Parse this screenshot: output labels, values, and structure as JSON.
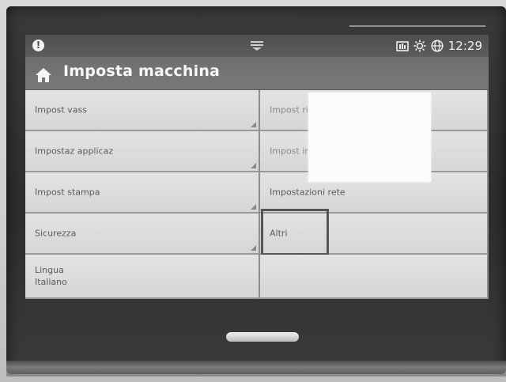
{
  "statusbar": {
    "alert_icon": "info-alert-icon",
    "time": "12:29",
    "icons": [
      "toner-icon",
      "sleep-brightness-icon",
      "network-globe-icon"
    ]
  },
  "header": {
    "title": "Imposta macchina",
    "home_icon": "home-icon"
  },
  "menu": {
    "left": [
      {
        "label": "Impost vass"
      },
      {
        "label": "Impostaz applicaz"
      },
      {
        "label": "Impost stampa"
      },
      {
        "label": "Sicurezza"
      },
      {
        "label": "Lingua",
        "value": "Italiano"
      }
    ],
    "right": [
      {
        "label": "Impost risp"
      },
      {
        "label": "Impost inizial"
      },
      {
        "label": "Impostazioni rete"
      },
      {
        "label": "Altri"
      }
    ]
  },
  "colors": {
    "statusbar": "#545454",
    "titlebar": "#747474",
    "cell_bg": "#dedede",
    "text": "#5a5a5a"
  }
}
